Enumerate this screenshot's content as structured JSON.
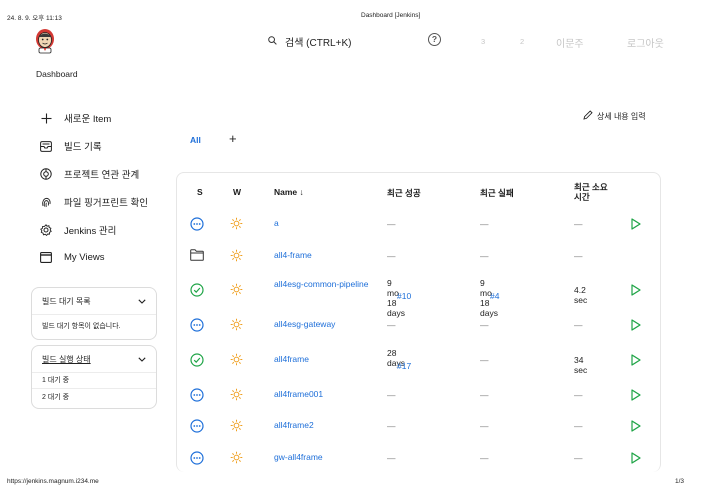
{
  "print": {
    "datetime": "24. 8. 9. 오후 11:13",
    "doc_title": "Dashboard [Jenkins]",
    "url": "https://jenkins.magnum.i234.me",
    "page": "1/3"
  },
  "header": {
    "search_label": "검색 (CTRL+K)",
    "help_label": "?",
    "count_a": "3",
    "count_b": "2",
    "user": "이문주",
    "logout": "로그아웃"
  },
  "breadcrumb": "Dashboard",
  "sidebar": {
    "items": [
      {
        "label": "새로운 Item",
        "icon": "plus-icon"
      },
      {
        "label": "빌드 기록",
        "icon": "inbox-icon"
      },
      {
        "label": "프로젝트 연관 관계",
        "icon": "relationship-icon"
      },
      {
        "label": "파일 핑거프린트 확인",
        "icon": "fingerprint-icon"
      },
      {
        "label": "Jenkins 관리",
        "icon": "gear-icon"
      },
      {
        "label": "My Views",
        "icon": "window-icon"
      }
    ],
    "build_queue": {
      "title": "빌드 대기 목록",
      "empty": "빌드 대기 항목이 없습니다."
    },
    "executors": {
      "title": "빌드 실행 상태",
      "rows": [
        "1  대기 중",
        "2  대기 중"
      ]
    }
  },
  "tabs": {
    "all": "All",
    "add": "+"
  },
  "edit_description": "상세 내용 입력",
  "table": {
    "headers": {
      "s": "S",
      "w": "W",
      "name": "Name  ↓",
      "last_success": "최근 성공",
      "last_failure": "최근 실패",
      "last_duration": "최근 소요 시간"
    },
    "rows": [
      {
        "status": "pending",
        "name": "a",
        "success": "—",
        "success_build": "",
        "failure": "—",
        "failure_build": "",
        "duration": "—",
        "run": true
      },
      {
        "status": "folder",
        "name": "all4-frame",
        "success": "—",
        "success_build": "",
        "failure": "—",
        "failure_build": "",
        "duration": "—",
        "run": false
      },
      {
        "status": "success",
        "name": "all4esg-common-pipeline",
        "success": "9 mo 18 days",
        "success_build": "#10",
        "failure": "9 mo 18 days",
        "failure_build": "#4",
        "duration": "4.2 sec",
        "run": true
      },
      {
        "status": "pending",
        "name": "all4esg-gateway",
        "success": "—",
        "success_build": "",
        "failure": "—",
        "failure_build": "",
        "duration": "—",
        "run": true
      },
      {
        "status": "success",
        "name": "all4frame",
        "success": "28 days",
        "success_build": "#17",
        "failure": "—",
        "failure_build": "",
        "duration": "34 sec",
        "run": true
      },
      {
        "status": "pending",
        "name": "all4frame001",
        "success": "—",
        "success_build": "",
        "failure": "—",
        "failure_build": "",
        "duration": "—",
        "run": true
      },
      {
        "status": "pending",
        "name": "all4frame2",
        "success": "—",
        "success_build": "",
        "failure": "—",
        "failure_build": "",
        "duration": "—",
        "run": true
      },
      {
        "status": "pending",
        "name": "gw-all4frame",
        "success": "—",
        "success_build": "",
        "failure": "—",
        "failure_build": "",
        "duration": "—",
        "run": true
      }
    ]
  },
  "colors": {
    "accent": "#1e6fd9",
    "success": "#1ea446",
    "weather": "#f0a020"
  }
}
